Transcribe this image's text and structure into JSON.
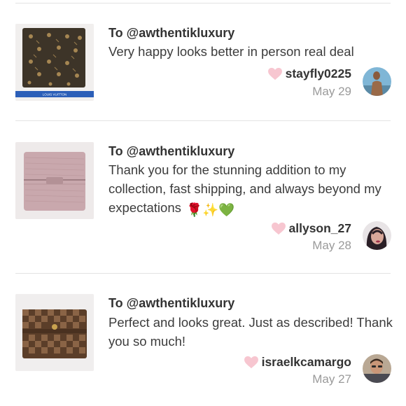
{
  "reviews": [
    {
      "to": "To @awthentikluxury",
      "comment": "Very happy looks better in person real deal",
      "emoji": "",
      "username": "stayfly0225",
      "date": "May 29",
      "thumb_icon": "monogram-wallet",
      "thumb_strap_text": "LOUIS VUITTON"
    },
    {
      "to": "To @awthentikluxury",
      "comment": "Thank you for the stunning addition to my collection, fast shipping, and always beyond my expectations",
      "emoji": "🌹✨💚",
      "username": "allyson_27",
      "date": "May 28",
      "thumb_icon": "pink-epi-wallet"
    },
    {
      "to": "To @awthentikluxury",
      "comment": "Perfect and looks great. Just as described! Thank you so much!",
      "emoji": "",
      "username": "israelkcamargo",
      "date": "May 27",
      "thumb_icon": "damier-wallet"
    }
  ],
  "colors": {
    "heart": "#f7c6d0",
    "divider": "#e3e3e3",
    "date_text": "#9a9a9a"
  }
}
